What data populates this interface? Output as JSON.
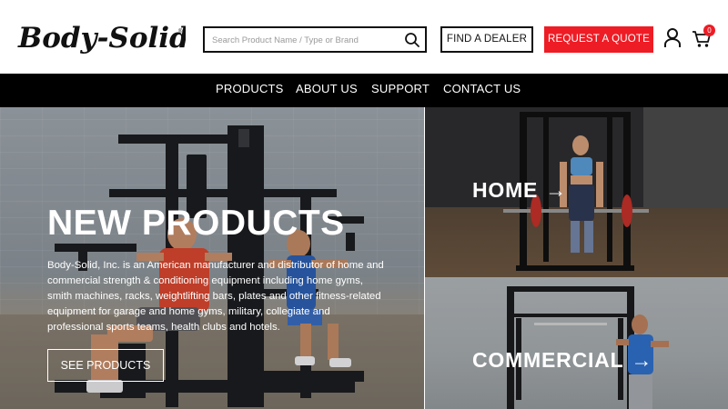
{
  "header": {
    "logo_text": "Body-Solid",
    "search": {
      "placeholder": "Search Product Name / Type or Brand",
      "value": ""
    },
    "find_dealer_label": "FIND A DEALER",
    "request_quote_label": "REQUEST A QUOTE",
    "cart_count": "0"
  },
  "nav": {
    "items": [
      {
        "label": "PRODUCTS"
      },
      {
        "label": "ABOUT US"
      },
      {
        "label": "SUPPORT"
      },
      {
        "label": "CONTACT US"
      }
    ]
  },
  "hero": {
    "title": "NEW PRODUCTS",
    "description": "Body-Solid, Inc. is an American manufacturer and distributor of home and commercial strength & conditioning equipment including home gyms, smith machines, racks, weightlifting bars, plates and other fitness-related equipment for garage and home gyms, military, collegiate and professional sports teams, health clubs and hotels.",
    "cta_label": "SEE PRODUCTS"
  },
  "tiles": {
    "home": {
      "label": "HOME",
      "arrow": "→"
    },
    "commercial": {
      "label": "COMMERCIAL",
      "arrow": "→"
    }
  },
  "colors": {
    "brand_red": "#ee1c25",
    "nav_bg": "#000000",
    "text_dark": "#111111"
  },
  "icons": {
    "search": "search-icon",
    "user": "user-icon",
    "cart": "cart-icon",
    "arrow": "arrow-right-icon"
  }
}
